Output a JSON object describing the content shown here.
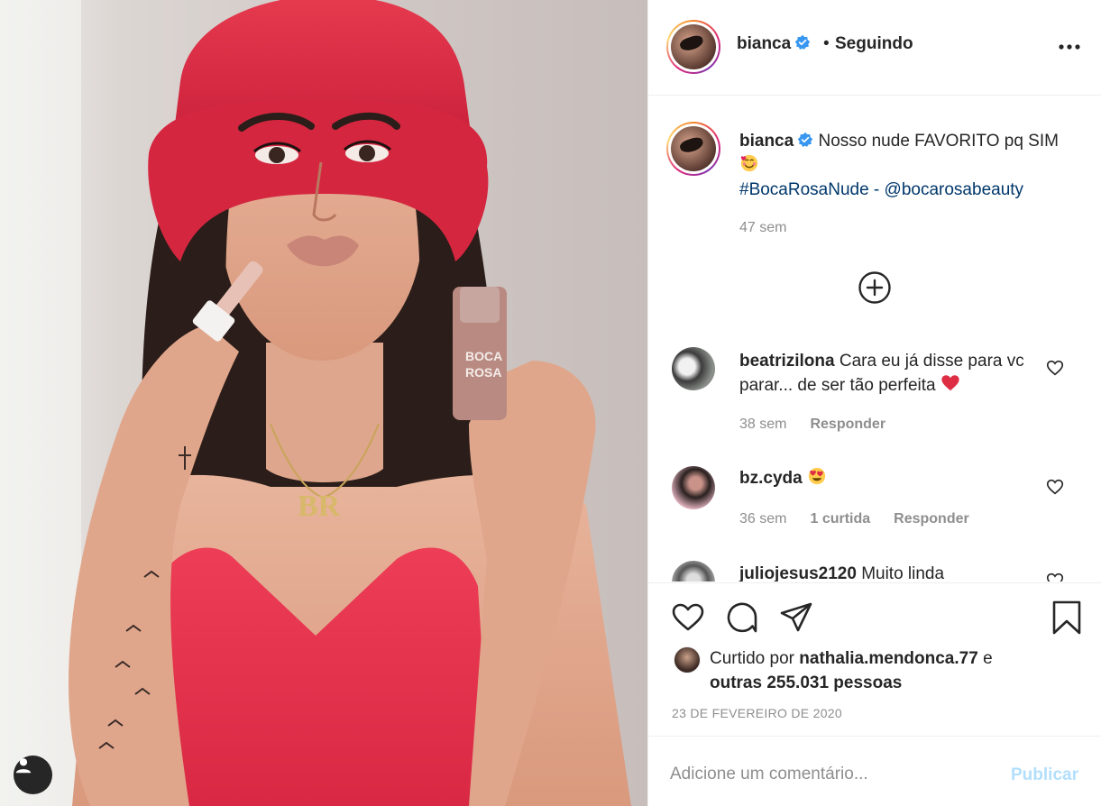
{
  "post": {
    "image_alt": "Woman in red bucket hat applying lip gloss",
    "tag_icon": "user-tag-icon",
    "product_label_line1": "BOCA",
    "product_label_line2": "ROSA",
    "necklace_text": "BR"
  },
  "header": {
    "username": "bianca",
    "verified_icon": "verified-badge-icon",
    "separator": "•",
    "follow_status": "Seguindo",
    "more_icon": "more-options-icon"
  },
  "caption": {
    "username": "bianca",
    "text_1": "Nosso nude FAVORITO pq SIM",
    "hashtag": "#BocaRosaNude",
    "separator": " - ",
    "mention": "@bocarosabeauty",
    "time": "47 sem",
    "load_more_icon": "plus-circle-icon"
  },
  "comments": [
    {
      "username": "beatrizilona",
      "text": "Cara eu já disse para vc parar... de ser tão perfeita",
      "emoji": "red-heart-emoji",
      "time": "38 sem",
      "reply": "Responder"
    },
    {
      "username": "bz.cyda",
      "text": "",
      "emoji": "heart-eyes-emoji",
      "time": "36 sem",
      "likes": "1 curtida",
      "reply": "Responder"
    },
    {
      "username": "juliojesus2120",
      "text": "Muito linda"
    }
  ],
  "actions": {
    "like_icon": "heart-icon",
    "comment_icon": "comment-icon",
    "share_icon": "paper-plane-icon",
    "save_icon": "bookmark-icon"
  },
  "likes": {
    "prefix": "Curtido por",
    "user": "nathalia.mendonca.77",
    "joiner": "e",
    "others": "outras 255.031 pessoas"
  },
  "date": "23 DE FEVEREIRO DE 2020",
  "comment_box": {
    "placeholder": "Adicione um comentário...",
    "publish": "Publicar"
  },
  "colors": {
    "link": "#00376b",
    "muted": "#8e8e8e",
    "publish_disabled": "#b2dffc",
    "verified": "#3897f0"
  }
}
